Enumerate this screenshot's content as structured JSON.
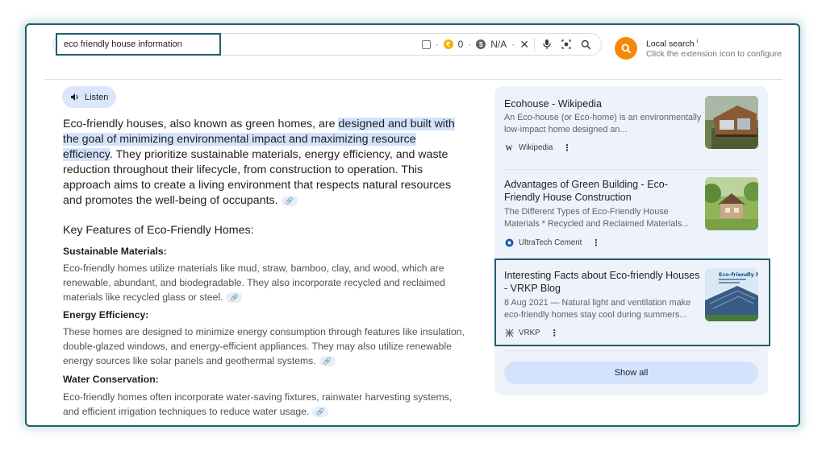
{
  "search": {
    "query": "eco friendly house information",
    "badge_count": "0",
    "na_label": "N/A",
    "close_glyph": "✕"
  },
  "local": {
    "title": "Local search",
    "info_mark": "i",
    "subtitle": "Click the extension icon to configure"
  },
  "answer": {
    "listen_label": "Listen",
    "intro_before": "Eco-friendly houses, also known as green homes, are ",
    "intro_highlight": "designed and built with the goal of minimizing environmental impact and maximizing resource efficiency",
    "intro_after": ". They prioritize sustainable materials, energy efficiency, and waste reduction throughout their lifecycle, from construction to operation. This approach aims to create a living environment that respects natural resources and promotes the well-being of occupants.",
    "heading": "Key Features of Eco-Friendly Homes:",
    "sections": [
      {
        "title": "Sustainable Materials:",
        "body": "Eco-friendly homes utilize materials like mud, straw, bamboo, clay, and wood, which are renewable, abundant, and biodegradable. They also incorporate recycled and reclaimed materials like recycled glass or steel."
      },
      {
        "title": "Energy Efficiency:",
        "body": "These homes are designed to minimize energy consumption through features like insulation, double-glazed windows, and energy-efficient appliances. They may also utilize renewable energy sources like solar panels and geothermal systems."
      },
      {
        "title": "Water Conservation:",
        "body": "Eco-friendly homes often incorporate water-saving fixtures, rainwater harvesting systems, and efficient irrigation techniques to reduce water usage."
      }
    ]
  },
  "sources": {
    "cards": [
      {
        "title": "Ecohouse - Wikipedia",
        "snippet": "An Eco-house (or Eco-home) is an environmentally low-impact home designed an...",
        "source": "Wikipedia",
        "source_glyph": "W"
      },
      {
        "title": "Advantages of Green Building - Eco-Friendly House Construction",
        "snippet": "The Different Types of Eco-Friendly House Materials * Recycled and Reclaimed Materials...",
        "source": "UltraTech Cement"
      },
      {
        "title": "Interesting Facts about Eco-friendly Houses - VRKP Blog",
        "snippet": "8 Aug 2021 — Natural light and ventilation make eco-friendly homes stay cool during summers...",
        "source": "VRKP",
        "thumb_text": "Eco-friendly h"
      }
    ],
    "show_all": "Show all"
  },
  "colors": {
    "accent_teal": "#1d5f6b",
    "highlight": "#d3e3fd",
    "local_orange": "#f58a0a"
  }
}
